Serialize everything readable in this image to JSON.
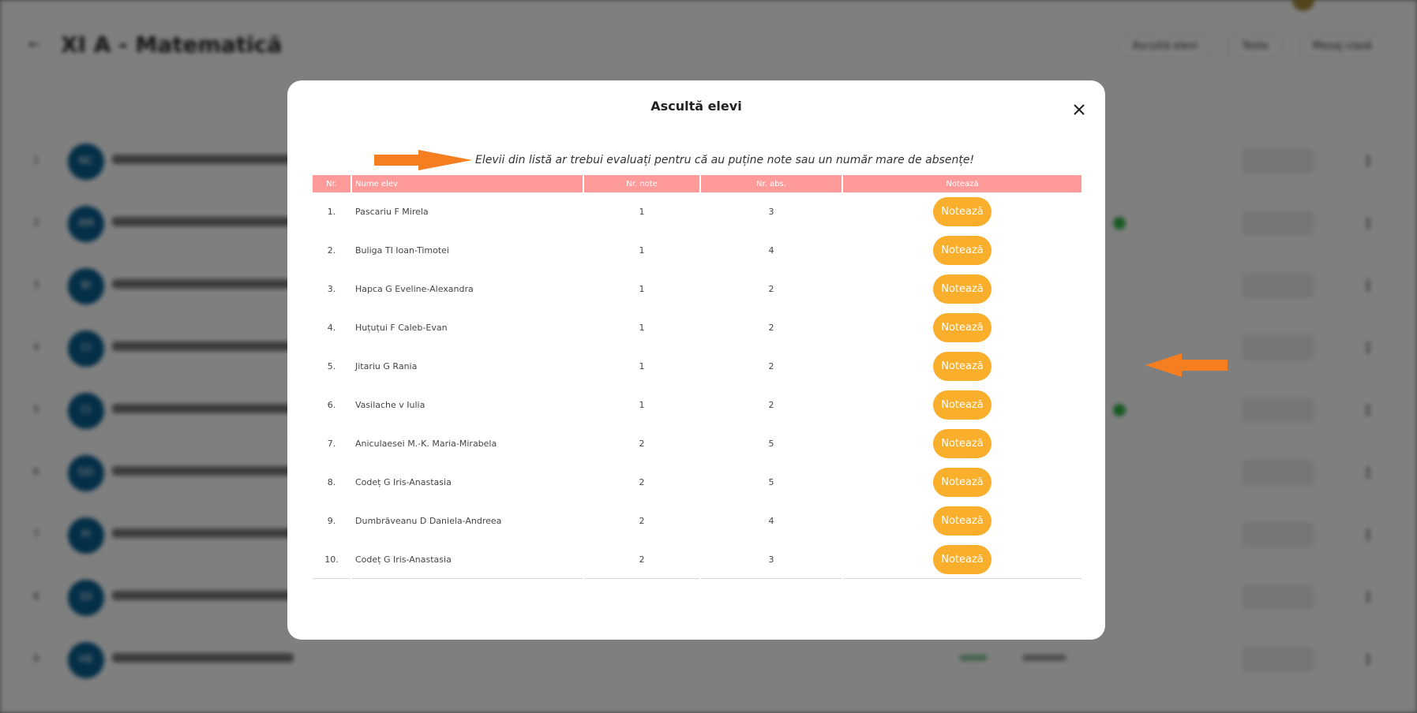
{
  "background": {
    "page_title": "XI A - Matematică",
    "actions": [
      "Ascultă elevi",
      "Teste",
      "Mesaj clasă"
    ],
    "rows": [
      "NC",
      "AM",
      "BI",
      "CI",
      "CI",
      "DD",
      "PI",
      "SS",
      "HE"
    ]
  },
  "modal": {
    "title": "Ascultă elevi",
    "hint": "Elevii din listă ar trebui evaluați pentru că au puține note sau un număr mare de absențe!",
    "columns": [
      "Nr.",
      "Nume elev",
      "Nr. note",
      "Nr. abs.",
      "Notează"
    ],
    "button_label": "Notează",
    "students": [
      {
        "nr": "1.",
        "name": "Pascariu F Mirela",
        "notes": "1",
        "absences": "3"
      },
      {
        "nr": "2.",
        "name": "Buliga TI Ioan-Timotei",
        "notes": "1",
        "absences": "4"
      },
      {
        "nr": "3.",
        "name": "Hapca G Eveline-Alexandra",
        "notes": "1",
        "absences": "2"
      },
      {
        "nr": "4.",
        "name": "Huțuțui F Caleb-Evan",
        "notes": "1",
        "absences": "2"
      },
      {
        "nr": "5.",
        "name": "Jitariu G Rania",
        "notes": "1",
        "absences": "2"
      },
      {
        "nr": "6.",
        "name": "Vasilache v Iulia",
        "notes": "1",
        "absences": "2"
      },
      {
        "nr": "7.",
        "name": "Aniculaesei M.-K. Maria-Mirabela",
        "notes": "2",
        "absences": "5"
      },
      {
        "nr": "8.",
        "name": "Codeț G Iris-Anastasia",
        "notes": "2",
        "absences": "5"
      },
      {
        "nr": "9.",
        "name": "Dumbrăveanu D Daniela-Andreea",
        "notes": "2",
        "absences": "4"
      },
      {
        "nr": "10.",
        "name": "Codeț G Iris-Anastasia",
        "notes": "2",
        "absences": "3"
      }
    ]
  },
  "colors": {
    "header_bg": "#ff9a9a",
    "button_bg": "#f9ae2c",
    "annotation_arrow": "#f57e20",
    "avatar_bg": "#075e8f"
  }
}
